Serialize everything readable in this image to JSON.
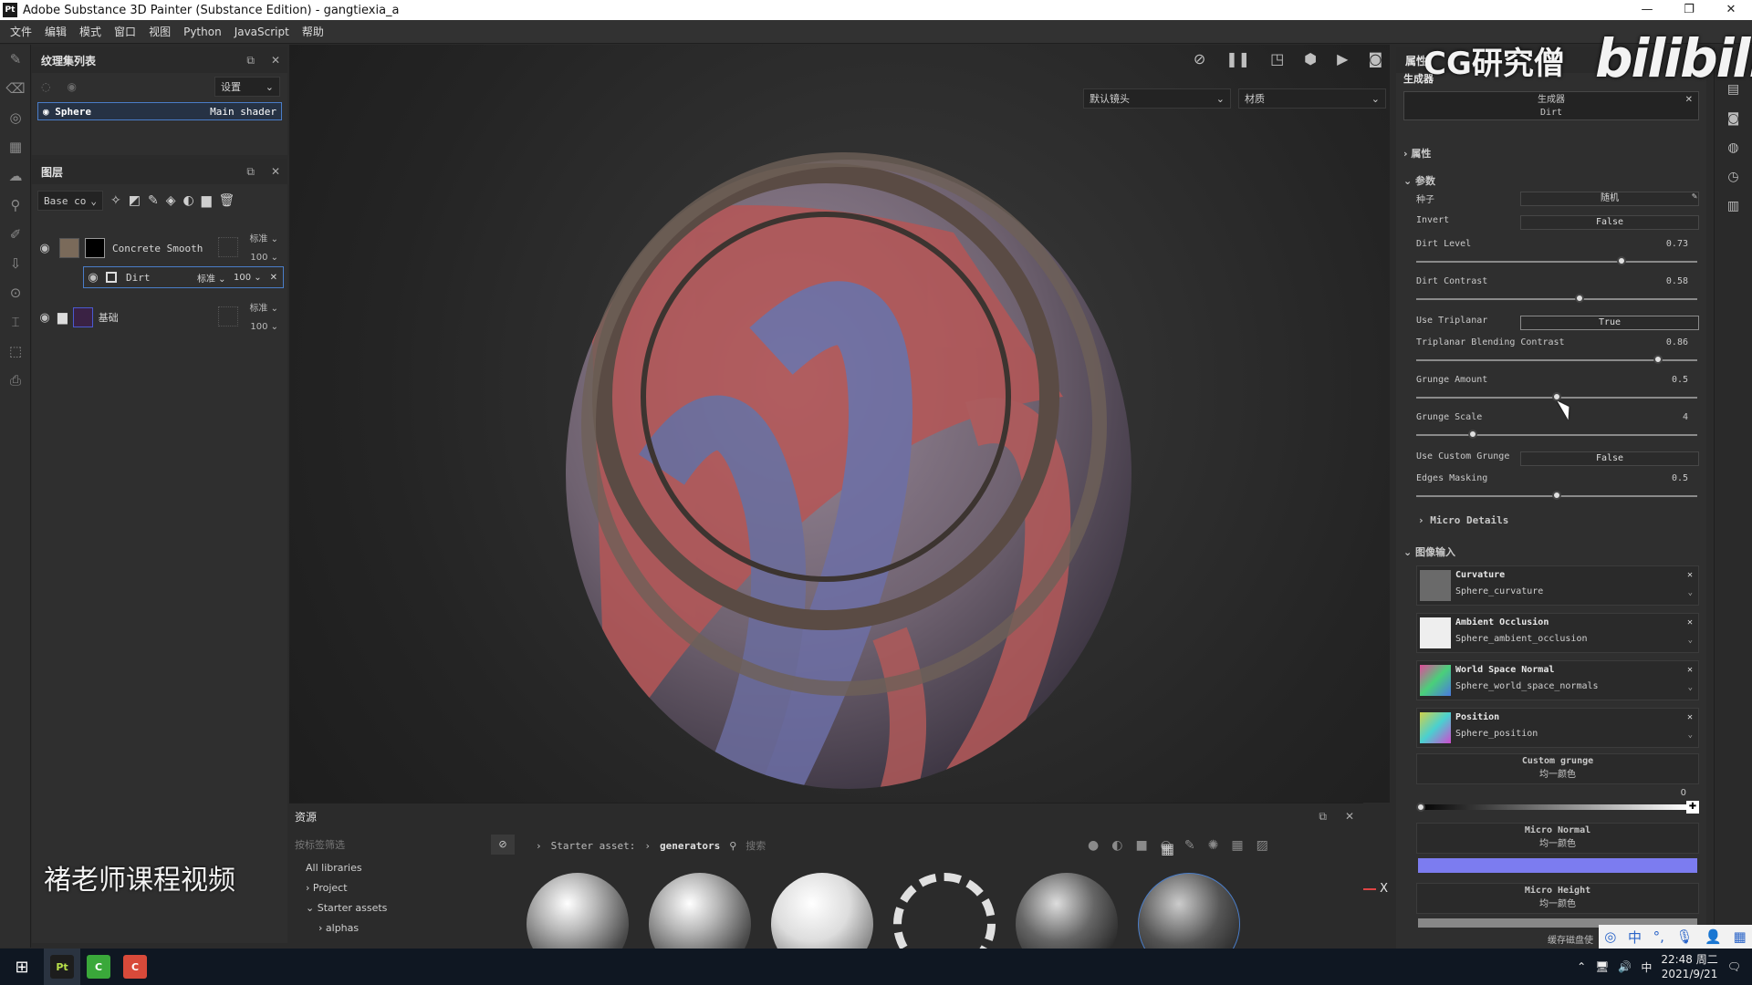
{
  "titlebar": {
    "app_icon": "Pt",
    "title": "Adobe Substance 3D Painter (Substance Edition) - gangtiexia_a",
    "minimize": "—",
    "maximize": "❐",
    "close": "✕"
  },
  "menu": [
    "文件",
    "编辑",
    "模式",
    "窗口",
    "视图",
    "Python",
    "JavaScript",
    "帮助"
  ],
  "texture_set_list": {
    "title": "纹理集列表",
    "settings_label": "设置",
    "set_name": "Sphere",
    "shader": "Main shader"
  },
  "layers": {
    "title": "图层",
    "channel_dropdown": "Base co",
    "items": [
      {
        "name": "Concrete Smooth",
        "blend": "标准",
        "opacity": "100"
      },
      {
        "name": "Dirt",
        "blend": "标准",
        "opacity": "100"
      },
      {
        "name": "基础",
        "blend": "标准",
        "opacity": "100"
      }
    ]
  },
  "viewport": {
    "camera_dropdown": "默认镜头",
    "material_dropdown": "材质",
    "axis_label": "X"
  },
  "assets": {
    "title": "资源",
    "filter_placeholder": "按标签筛选",
    "libraries": [
      "All libraries",
      "Project",
      "Starter assets",
      "alphas"
    ],
    "breadcrumb_1": "Starter asset:",
    "breadcrumb_2": "generators",
    "search_placeholder": "搜索"
  },
  "properties": {
    "tab_1": "属性",
    "section_generator": "生成器",
    "generator_title": "生成器",
    "generator_name": "Dirt",
    "section_attributes": "属性",
    "section_params": "参数",
    "seed_label": "种子",
    "seed_value": "随机",
    "invert_label": "Invert",
    "invert_value": "False",
    "dirt_level_label": "Dirt Level",
    "dirt_level_value": "0.73",
    "dirt_contrast_label": "Dirt Contrast",
    "dirt_contrast_value": "0.58",
    "use_triplanar_label": "Use Triplanar",
    "use_triplanar_value": "True",
    "triplanar_contrast_label": "Triplanar Blending Contrast",
    "triplanar_contrast_value": "0.86",
    "grunge_amount_label": "Grunge Amount",
    "grunge_amount_value": "0.5",
    "grunge_scale_label": "Grunge Scale",
    "grunge_scale_value": "4",
    "use_custom_grunge_label": "Use Custom Grunge",
    "use_custom_grunge_value": "False",
    "edges_masking_label": "Edges Masking",
    "edges_masking_value": "0.5",
    "micro_details": "Micro Details",
    "section_image_inputs": "图像输入",
    "inputs": [
      {
        "name": "Curvature",
        "source": "Sphere_curvature"
      },
      {
        "name": "Ambient Occlusion",
        "source": "Sphere_ambient_occlusion"
      },
      {
        "name": "World Space Normal",
        "source": "Sphere_world_space_normals"
      },
      {
        "name": "Position",
        "source": "Sphere_position"
      }
    ],
    "custom_grunge_title": "Custom grunge",
    "custom_grunge_sub": "均一颜色",
    "custom_grunge_value": "0",
    "micro_normal_title": "Micro Normal",
    "micro_normal_sub": "均一颜色",
    "micro_height_title": "Micro Height",
    "micro_height_sub": "均一颜色",
    "cache_label": "缓存磁盘使"
  },
  "slider_levels": {
    "dirt_level": 0.73,
    "dirt_contrast": 0.58,
    "triplanar": 0.86,
    "grunge_amount": 0.5,
    "grunge_scale": 0.2,
    "edges_masking": 0.5
  },
  "overlay": {
    "watermark": "CG研究僧",
    "bilibili": "bilibili",
    "caption": "褚老师课程视频"
  },
  "taskbar": {
    "ime_lang": "中",
    "time": "22:48 周二",
    "date": "2021/9/21"
  },
  "colors": {
    "accent_blue": "#4a7dc8",
    "micro_normal_swatch": "#7c7cf0"
  }
}
